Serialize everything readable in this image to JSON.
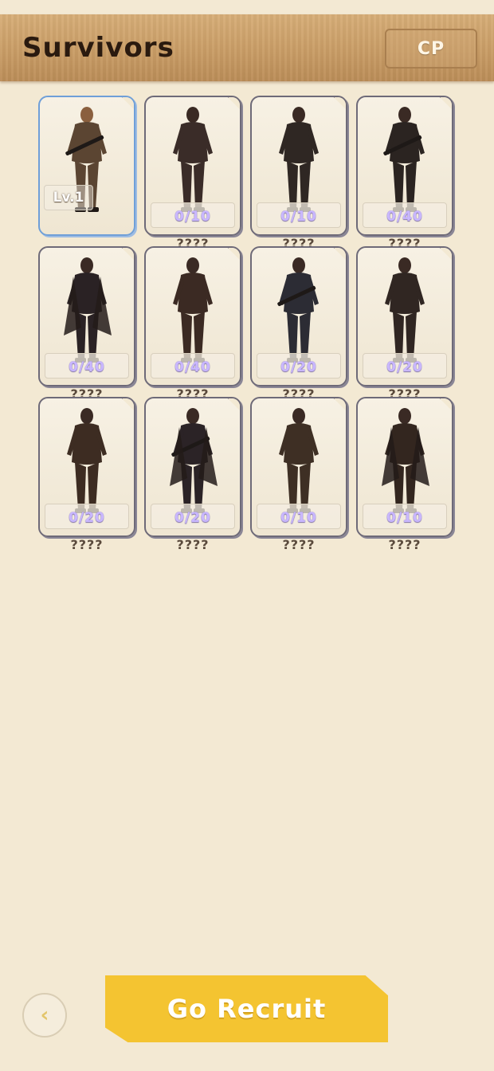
{
  "header": {
    "title": "Survivors",
    "cp_label": "CP"
  },
  "survivors": [
    {
      "progress": "",
      "level": "Lv.1",
      "name": "",
      "owned": true
    },
    {
      "progress": "0/10",
      "level": "",
      "name": "????",
      "owned": false
    },
    {
      "progress": "0/10",
      "level": "",
      "name": "????",
      "owned": false
    },
    {
      "progress": "0/40",
      "level": "",
      "name": "????",
      "owned": false
    },
    {
      "progress": "0/40",
      "level": "",
      "name": "????",
      "owned": false
    },
    {
      "progress": "0/40",
      "level": "",
      "name": "????",
      "owned": false
    },
    {
      "progress": "0/20",
      "level": "",
      "name": "????",
      "owned": false
    },
    {
      "progress": "0/20",
      "level": "",
      "name": "????",
      "owned": false
    },
    {
      "progress": "0/20",
      "level": "",
      "name": "????",
      "owned": false
    },
    {
      "progress": "0/20",
      "level": "",
      "name": "????",
      "owned": false
    },
    {
      "progress": "0/10",
      "level": "",
      "name": "????",
      "owned": false
    },
    {
      "progress": "0/10",
      "level": "",
      "name": "????",
      "owned": false
    }
  ],
  "footer": {
    "back_icon": "chevron-left-icon",
    "back_glyph": "‹",
    "recruit_label": "Go Recruit"
  },
  "colors": {
    "header_wood": "#c99d66",
    "background": "#f3e9d3",
    "recruit_button": "#f4c431",
    "progress_text": "#c9b7ff",
    "owned_border": "#6f9fd8"
  }
}
